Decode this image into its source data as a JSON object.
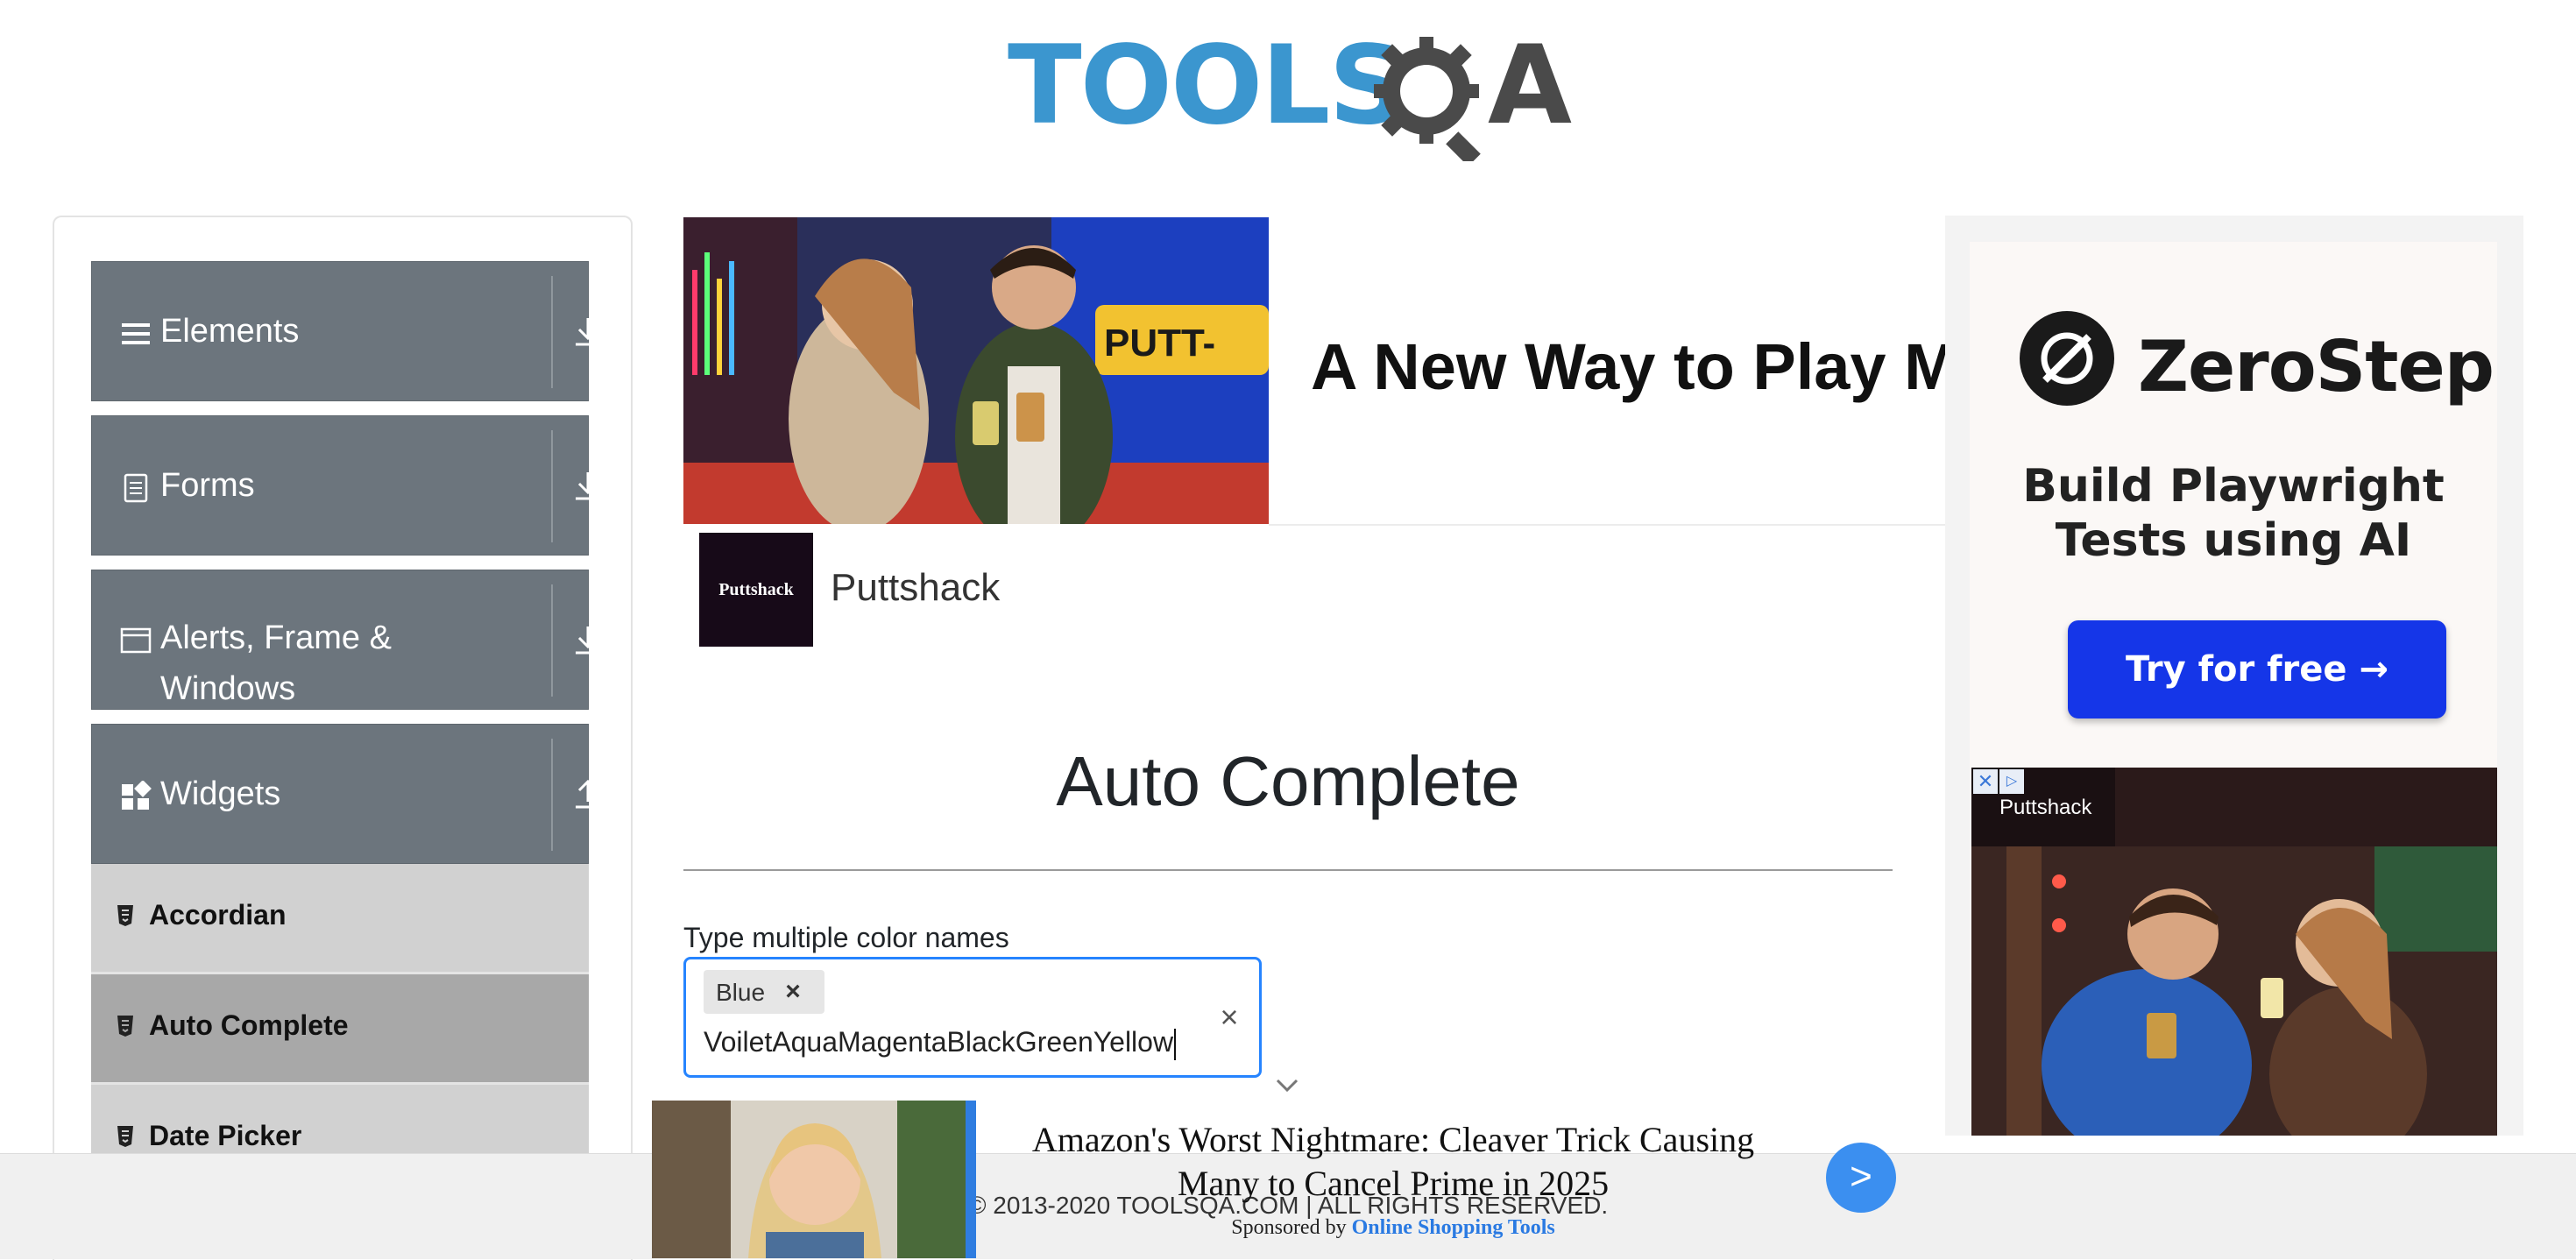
{
  "header": {
    "logo_main": "TOOLS",
    "logo_end": "A",
    "logo_alt": "TOOLSQA"
  },
  "sidebar": {
    "groups": [
      {
        "label": "Elements",
        "icon": "hamburger-icon",
        "arrow": "download-icon"
      },
      {
        "label": "Forms",
        "icon": "document-icon",
        "arrow": "download-icon"
      },
      {
        "label": "Alerts, Frame & Windows",
        "label_line1": "Alerts, Frame &",
        "label_line2": "Windows",
        "icon": "window-icon",
        "arrow": "download-icon"
      },
      {
        "label": "Widgets",
        "icon": "widgets-icon",
        "arrow": "upload-icon"
      }
    ],
    "items": [
      {
        "label": "Accordian",
        "active": false
      },
      {
        "label": "Auto Complete",
        "active": true
      },
      {
        "label": "Date Picker",
        "active": false
      }
    ]
  },
  "top_ad": {
    "headline": "A New Way to Play Mir",
    "sign_text": "PUTT-",
    "brand_logo": "Puttshack",
    "brand_name": "Puttshack"
  },
  "main": {
    "title": "Auto Complete",
    "field_label": "Type multiple color names",
    "chips": [
      {
        "text": "Blue",
        "remove": "×"
      }
    ],
    "typed_value": "VoiletAquaMagentaBlackGreenYellow",
    "clear": "×"
  },
  "right_ad": {
    "brand": "ZeroStep",
    "tagline_1": "Build Playwright",
    "tagline_2": "Tests using AI",
    "cta": "Try for free →",
    "ad2_close": "✕",
    "ad2_info": "▷",
    "ad2_brand": "Puttshack"
  },
  "sponsored": {
    "headline": "Amazon's Worst Nightmare: Cleaver Trick Causing Many to Cancel Prime in 2025",
    "sponsored_by": "Sponsored by",
    "sponsor": "Online Shopping Tools",
    "go": ">"
  },
  "footer": {
    "text": "© 2013-2020 TOOLSQA.COM | ALL RIGHTS RESERVED."
  },
  "colors": {
    "accent": "#2684ff",
    "logo_blue": "#3b96cf",
    "sidebar_group": "#6c757d",
    "sidebar_item": "#d1d1d1",
    "sidebar_item_active": "#a8a8a8",
    "cta_blue": "#1536e8"
  }
}
